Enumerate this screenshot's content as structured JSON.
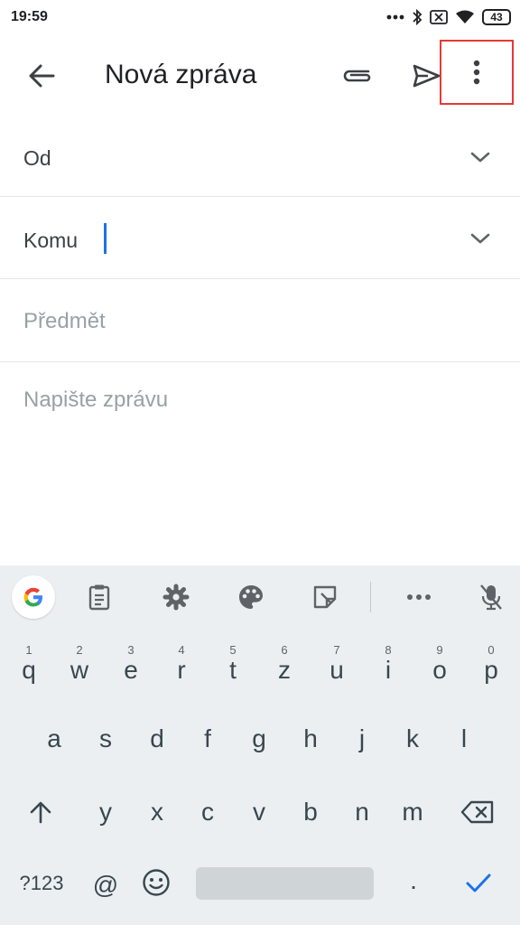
{
  "status_bar": {
    "time": "19:59",
    "battery": "43",
    "icons": [
      "more-dots-icon",
      "bluetooth-icon",
      "sim-off-icon",
      "wifi-icon",
      "battery-icon"
    ]
  },
  "app_bar": {
    "title": "Nová zpráva",
    "icons": [
      "back-arrow-icon",
      "attachment-icon",
      "send-icon",
      "more-vert-icon"
    ],
    "highlight_color": "#e53935"
  },
  "compose": {
    "from_label": "Od",
    "to_label": "Komu",
    "subject_placeholder": "Předmět",
    "body_placeholder": "Napište zprávu",
    "caret_color": "#1a73e8"
  },
  "keyboard": {
    "toolbar_icons": [
      "google-icon",
      "clipboard-icon",
      "settings-icon",
      "palette-icon",
      "sticker-icon",
      "more-horiz-icon",
      "mic-off-icon"
    ],
    "row1": [
      {
        "num": "1",
        "ch": "q"
      },
      {
        "num": "2",
        "ch": "w"
      },
      {
        "num": "3",
        "ch": "e"
      },
      {
        "num": "4",
        "ch": "r"
      },
      {
        "num": "5",
        "ch": "t"
      },
      {
        "num": "6",
        "ch": "z"
      },
      {
        "num": "7",
        "ch": "u"
      },
      {
        "num": "8",
        "ch": "i"
      },
      {
        "num": "9",
        "ch": "o"
      },
      {
        "num": "0",
        "ch": "p"
      }
    ],
    "row2": [
      "a",
      "s",
      "d",
      "f",
      "g",
      "h",
      "j",
      "k",
      "l"
    ],
    "row3": [
      "y",
      "x",
      "c",
      "v",
      "b",
      "n",
      "m"
    ],
    "sym_label": "?123",
    "at_label": "@",
    "period_label": "."
  }
}
